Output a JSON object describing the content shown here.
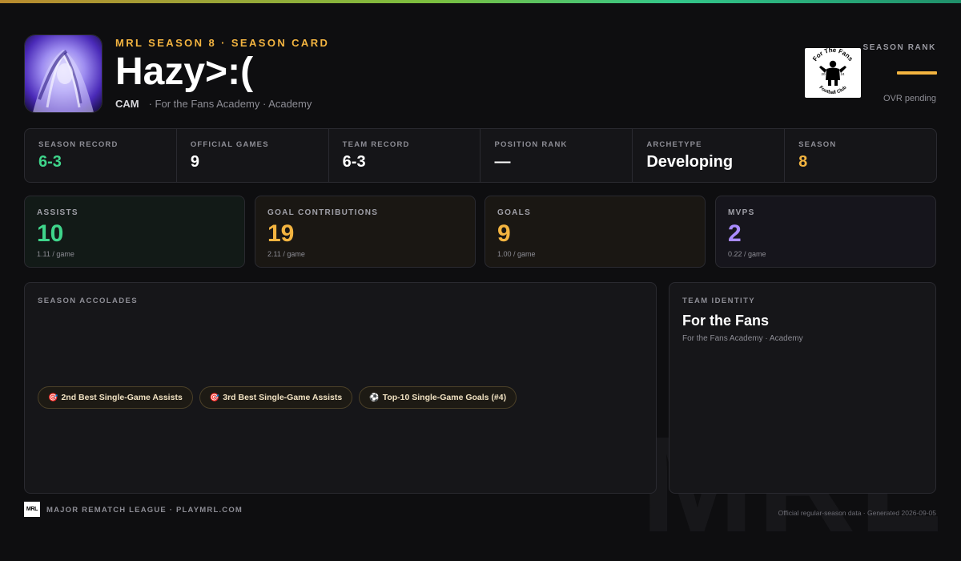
{
  "colors": {
    "accent_gold": "#f3b440",
    "green": "#3fd58b",
    "purple": "#a98bff",
    "background": "#0e0e10"
  },
  "header": {
    "kicker": "MRL SEASON 8 · SEASON CARD",
    "player_name": "Hazy>:(",
    "position": "CAM",
    "team_line": "· For the Fans Academy · Academy",
    "team_logo_top_text": "For The Fans",
    "team_logo_bottom_text": "Football Club",
    "team_logo_year_left": "20",
    "team_logo_year_right": "24",
    "season_rank_label": "SEASON RANK",
    "season_rank_status": "OVR pending"
  },
  "info_row": [
    {
      "label": "SEASON RECORD",
      "value": "6-3",
      "color": "#3fd58b"
    },
    {
      "label": "OFFICIAL GAMES",
      "value": "9",
      "color": "#ffffff"
    },
    {
      "label": "TEAM RECORD",
      "value": "6-3",
      "color": "#ffffff"
    },
    {
      "label": "POSITION RANK",
      "value": "—",
      "color": "#ffffff"
    },
    {
      "label": "ARCHETYPE",
      "value": "Developing",
      "color": "#ffffff"
    },
    {
      "label": "SEASON",
      "value": "8",
      "color": "#f3b440"
    }
  ],
  "stats": [
    {
      "label": "ASSISTS",
      "value": "10",
      "per_game": "1.11 / game",
      "color": "#3fd58b",
      "tint": "#121a17"
    },
    {
      "label": "GOAL CONTRIBUTIONS",
      "value": "19",
      "per_game": "2.11 / game",
      "color": "#f3b440",
      "tint": "#1a1713"
    },
    {
      "label": "GOALS",
      "value": "9",
      "per_game": "1.00 / game",
      "color": "#f3b440",
      "tint": "#1a1713"
    },
    {
      "label": "MVPS",
      "value": "2",
      "per_game": "0.22 / game",
      "color": "#a98bff",
      "tint": "#16151c"
    }
  ],
  "accolades": {
    "label": "SEASON ACCOLADES",
    "items": [
      {
        "icon": "target-icon",
        "glyph": "🎯",
        "text": "2nd Best Single-Game Assists"
      },
      {
        "icon": "target-icon",
        "glyph": "🎯",
        "text": "3rd Best Single-Game Assists"
      },
      {
        "icon": "soccer-ball-icon",
        "glyph": "⚽",
        "text": "Top-10 Single-Game Goals (#4)"
      }
    ]
  },
  "team_identity": {
    "label": "TEAM IDENTITY",
    "team_name": "For the Fans",
    "team_sub": "For the Fans Academy · Academy"
  },
  "footer": {
    "logo_text": "MRL",
    "league": "MAJOR REMATCH LEAGUE · PLAYMRL.COM",
    "note": "Official regular-season data · Generated 2026-09-05",
    "watermark": "MRL"
  }
}
